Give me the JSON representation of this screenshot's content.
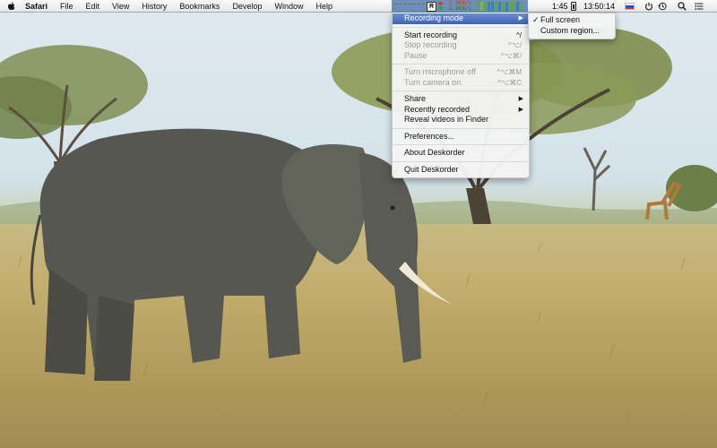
{
  "menubar": {
    "app_name": "Safari",
    "menus": [
      "File",
      "Edit",
      "View",
      "History",
      "Bookmarks",
      "Develop",
      "Window",
      "Help"
    ]
  },
  "status": {
    "app_icon_letter": "R",
    "upload_rate": "2.0KB/s",
    "download_rate": "1.6KB/s",
    "time_short": "1:45",
    "clock": "13:50:14",
    "icons": [
      "deskorder-icon",
      "network-monitor-icon",
      "cpu-monitor-icon",
      "battery-icon",
      "russian-flag-icon",
      "power-icon",
      "time-machine-icon",
      "spotlight-icon",
      "notification-list-icon"
    ]
  },
  "menu": {
    "items": [
      {
        "label": "Recording mode",
        "submenu": true,
        "highlighted": true
      },
      {
        "separator": true
      },
      {
        "label": "Start recording",
        "shortcut": "^/"
      },
      {
        "label": "Stop recording",
        "shortcut": "^⌥/",
        "disabled": true
      },
      {
        "label": "Pause",
        "shortcut": "^⌥⌘/",
        "disabled": true
      },
      {
        "separator": true
      },
      {
        "label": "Turn microphone off",
        "shortcut": "^⌥⌘M",
        "disabled": true
      },
      {
        "label": "Turn camera on",
        "shortcut": "^⌥⌘C",
        "disabled": true
      },
      {
        "separator": true
      },
      {
        "label": "Share",
        "submenu": true
      },
      {
        "label": "Recently recorded",
        "submenu": true
      },
      {
        "label": "Reveal videos in Finder"
      },
      {
        "separator": true
      },
      {
        "label": "Preferences..."
      },
      {
        "separator": true
      },
      {
        "label": "About Deskorder"
      },
      {
        "separator": true
      },
      {
        "label": "Quit Deskorder"
      }
    ],
    "submenu": {
      "items": [
        {
          "label": "Full screen",
          "checked": true,
          "check": "✓"
        },
        {
          "label": "Custom region..."
        }
      ]
    }
  }
}
